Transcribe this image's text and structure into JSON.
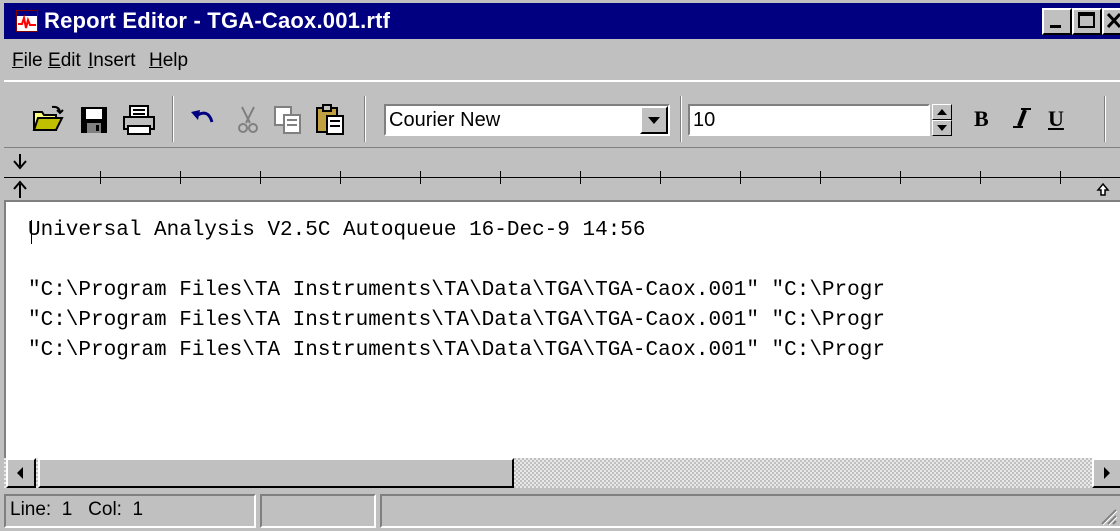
{
  "window": {
    "title": "Report Editor - TGA-Caox.001.rtf",
    "app_icon": "chart-wave-icon",
    "title_color": "#000080"
  },
  "menu": {
    "items": [
      {
        "mnemonic": "F",
        "rest": "ile"
      },
      {
        "mnemonic": "E",
        "rest": "dit"
      },
      {
        "mnemonic": "I",
        "rest": "nsert"
      },
      {
        "mnemonic": "H",
        "rest": "elp"
      }
    ]
  },
  "toolbar": {
    "icons": [
      "open-folder-icon",
      "save-disk-icon",
      "print-icon",
      "undo-icon",
      "cut-scissors-icon",
      "copy-icon",
      "paste-clipboard-icon"
    ],
    "font_name": "Courier New",
    "font_size": "10",
    "bold_label": "B",
    "italic_label": "I",
    "underline_label": "U"
  },
  "editor": {
    "lines": [
      "Universal Analysis V2.5C Autoqueue 16-Dec-9 14:56",
      "",
      "\"C:\\Program Files\\TA Instruments\\TA\\Data\\TGA\\TGA-Caox.001\" \"C:\\Progr",
      "\"C:\\Program Files\\TA Instruments\\TA\\Data\\TGA\\TGA-Caox.001\" \"C:\\Progr",
      "\"C:\\Program Files\\TA Instruments\\TA\\Data\\TGA\\TGA-Caox.001\" \"C:\\Progr"
    ]
  },
  "status": {
    "position": "Line:  1   Col:  1"
  }
}
